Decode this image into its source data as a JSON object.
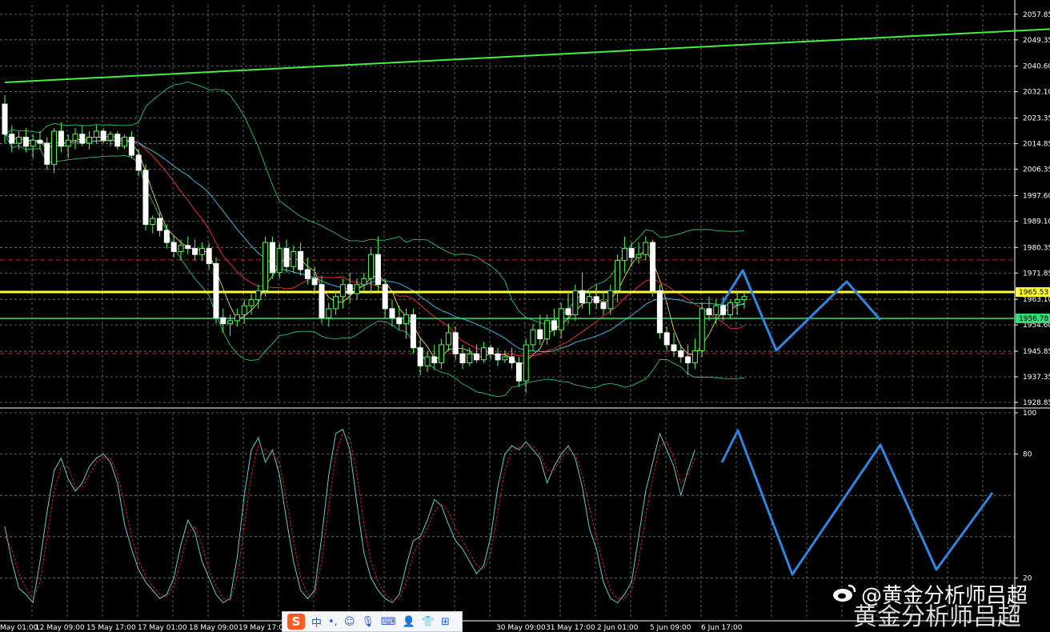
{
  "chart_data": [
    {
      "type": "candlestick",
      "panel": "price",
      "title": "",
      "ylim": [
        1928.85,
        2061
      ],
      "y_ticks": [
        "2057.85",
        "2049.35",
        "2040.60",
        "2032.10",
        "2023.35",
        "2014.85",
        "2006.35",
        "1997.60",
        "1989.10",
        "1980.35",
        "1971.85",
        "1963.10",
        "1954.60",
        "1945.85",
        "1937.35",
        "1928.85"
      ],
      "price_badges": [
        {
          "label": "1965.53",
          "value": 1965.53,
          "color": "#ffff33"
        },
        {
          "label": "1956.78",
          "value": 1956.78,
          "color": "#33dd77"
        }
      ],
      "horizontal_levels": [
        {
          "value": 1965.53,
          "color": "#ffff33",
          "style": "solid"
        },
        {
          "value": 1956.78,
          "color": "#33dd77",
          "style": "solid"
        },
        {
          "value": 1976.2,
          "color": "#cc2222",
          "style": "dashed"
        },
        {
          "value": 1945.1,
          "color": "#cc2222",
          "style": "dashed"
        }
      ],
      "trendline": {
        "from": [
          0,
          2035.2
        ],
        "to": [
          159,
          2054.2
        ],
        "color": "#44ee44"
      },
      "candles": [
        [
          2028,
          2031,
          2015,
          2018
        ],
        [
          2018,
          2021,
          2012,
          2015
        ],
        [
          2015,
          2019,
          2013,
          2017
        ],
        [
          2017,
          2020,
          2012,
          2014
        ],
        [
          2014,
          2018,
          2010,
          2016
        ],
        [
          2016,
          2019,
          2013,
          2015
        ],
        [
          2015,
          2017,
          2006,
          2008
        ],
        [
          2008,
          2020,
          2005,
          2019
        ],
        [
          2019,
          2022,
          2012,
          2014
        ],
        [
          2014,
          2018,
          2010,
          2016
        ],
        [
          2016,
          2020,
          2013,
          2018
        ],
        [
          2018,
          2021,
          2014,
          2015
        ],
        [
          2015,
          2019,
          2013,
          2017
        ],
        [
          2017,
          2021,
          2015,
          2019
        ],
        [
          2019,
          2020,
          2015,
          2016
        ],
        [
          2016,
          2019,
          2014,
          2018
        ],
        [
          2018,
          2019,
          2013,
          2014
        ],
        [
          2014,
          2018,
          2013,
          2017
        ],
        [
          2017,
          2019,
          2010,
          2011
        ],
        [
          2011,
          2013,
          2004,
          2006
        ],
        [
          2006,
          2008,
          1986,
          1988
        ],
        [
          1988,
          1991,
          1985,
          1990
        ],
        [
          1990,
          1992,
          1984,
          1986
        ],
        [
          1986,
          1988,
          1980,
          1982
        ],
        [
          1982,
          1984,
          1977,
          1979
        ],
        [
          1979,
          1983,
          1976,
          1981
        ],
        [
          1981,
          1984,
          1978,
          1980
        ],
        [
          1980,
          1983,
          1976,
          1978
        ],
        [
          1978,
          1982,
          1976,
          1980
        ],
        [
          1980,
          1982,
          1973,
          1975
        ],
        [
          1975,
          1977,
          1955,
          1957
        ],
        [
          1957,
          1960,
          1952,
          1955
        ],
        [
          1955,
          1958,
          1951,
          1956
        ],
        [
          1956,
          1960,
          1954,
          1958
        ],
        [
          1958,
          1963,
          1955,
          1961
        ],
        [
          1961,
          1965,
          1958,
          1963
        ],
        [
          1963,
          1968,
          1960,
          1966
        ],
        [
          1966,
          1984,
          1964,
          1982
        ],
        [
          1982,
          1984,
          1970,
          1972
        ],
        [
          1972,
          1982,
          1970,
          1980
        ],
        [
          1980,
          1983,
          1972,
          1974
        ],
        [
          1974,
          1981,
          1972,
          1979
        ],
        [
          1979,
          1982,
          1971,
          1973
        ],
        [
          1973,
          1977,
          1968,
          1970
        ],
        [
          1970,
          1974,
          1965,
          1968
        ],
        [
          1968,
          1971,
          1955,
          1957
        ],
        [
          1957,
          1962,
          1954,
          1960
        ],
        [
          1960,
          1966,
          1958,
          1964
        ],
        [
          1964,
          1970,
          1960,
          1968
        ],
        [
          1968,
          1972,
          1962,
          1965
        ],
        [
          1965,
          1970,
          1963,
          1968
        ],
        [
          1968,
          1972,
          1966,
          1970
        ],
        [
          1970,
          1980,
          1965,
          1978
        ],
        [
          1978,
          1984,
          1966,
          1968
        ],
        [
          1968,
          1970,
          1957,
          1960
        ],
        [
          1960,
          1963,
          1954,
          1957
        ],
        [
          1957,
          1961,
          1953,
          1955
        ],
        [
          1955,
          1960,
          1950,
          1958
        ],
        [
          1958,
          1960,
          1945,
          1947
        ],
        [
          1947,
          1950,
          1938,
          1941
        ],
        [
          1941,
          1946,
          1939,
          1944
        ],
        [
          1944,
          1948,
          1940,
          1942
        ],
        [
          1942,
          1950,
          1940,
          1948
        ],
        [
          1948,
          1955,
          1946,
          1952
        ],
        [
          1952,
          1954,
          1943,
          1945
        ],
        [
          1945,
          1948,
          1940,
          1942
        ],
        [
          1942,
          1947,
          1941,
          1945
        ],
        [
          1945,
          1948,
          1942,
          1943
        ],
        [
          1943,
          1949,
          1942,
          1947
        ],
        [
          1947,
          1948,
          1943,
          1945
        ],
        [
          1945,
          1947,
          1941,
          1943
        ],
        [
          1943,
          1946,
          1942,
          1944
        ],
        [
          1944,
          1947,
          1940,
          1942
        ],
        [
          1942,
          1944,
          1934,
          1936
        ],
        [
          1936,
          1950,
          1932,
          1948
        ],
        [
          1948,
          1955,
          1946,
          1953
        ],
        [
          1953,
          1958,
          1948,
          1950
        ],
        [
          1950,
          1958,
          1948,
          1956
        ],
        [
          1956,
          1960,
          1951,
          1953
        ],
        [
          1953,
          1962,
          1950,
          1960
        ],
        [
          1960,
          1965,
          1955,
          1958
        ],
        [
          1958,
          1968,
          1956,
          1966
        ],
        [
          1966,
          1972,
          1960,
          1962
        ],
        [
          1962,
          1966,
          1958,
          1964
        ],
        [
          1964,
          1968,
          1960,
          1962
        ],
        [
          1962,
          1966,
          1958,
          1960
        ],
        [
          1960,
          1968,
          1958,
          1966
        ],
        [
          1966,
          1978,
          1962,
          1976
        ],
        [
          1976,
          1984,
          1972,
          1980
        ],
        [
          1980,
          1982,
          1974,
          1977
        ],
        [
          1977,
          1982,
          1975,
          1978
        ],
        [
          1978,
          1984,
          1976,
          1982
        ],
        [
          1982,
          1983,
          1964,
          1966
        ],
        [
          1966,
          1968,
          1950,
          1952
        ],
        [
          1952,
          1954,
          1946,
          1948
        ],
        [
          1948,
          1952,
          1944,
          1946
        ],
        [
          1946,
          1948,
          1942,
          1944
        ],
        [
          1944,
          1948,
          1938,
          1942
        ],
        [
          1942,
          1950,
          1940,
          1946
        ],
        [
          1946,
          1962,
          1944,
          1960
        ],
        [
          1960,
          1964,
          1956,
          1958
        ],
        [
          1958,
          1963,
          1955,
          1961
        ],
        [
          1961,
          1964,
          1956,
          1958
        ],
        [
          1958,
          1963,
          1957,
          1962
        ],
        [
          1962,
          1965,
          1958,
          1963
        ],
        [
          1963,
          1966,
          1960,
          1964
        ]
      ],
      "x_labels": [
        "May 01:00",
        "12 May 09:00",
        "15 May 17:00",
        "17 May 01:00",
        "18 May 09:00",
        "19 May 17:00",
        "30 May 09:00",
        "31 May 17:00",
        "2 Jun 01:00",
        "5 Jun 09:00",
        "6 Jun 17:00"
      ],
      "projection_color": "#2f86e0"
    },
    {
      "type": "line",
      "panel": "oscillator",
      "title": "",
      "ylim": [
        0,
        100
      ],
      "y_ticks": [
        "100",
        "80",
        "20"
      ],
      "levels": [
        80,
        20
      ],
      "series": [
        {
          "color": "#66cccc",
          "style": "solid",
          "values": [
            45,
            28,
            15,
            12,
            8,
            28,
            52,
            72,
            78,
            68,
            62,
            66,
            74,
            78,
            80,
            76,
            66,
            46,
            34,
            24,
            18,
            14,
            10,
            12,
            20,
            36,
            48,
            42,
            28,
            20,
            12,
            8,
            10,
            30,
            60,
            82,
            88,
            76,
            82,
            70,
            48,
            28,
            14,
            10,
            14,
            40,
            70,
            90,
            92,
            82,
            56,
            32,
            20,
            14,
            10,
            8,
            12,
            26,
            38,
            40,
            48,
            58,
            55,
            46,
            38,
            34,
            28,
            22,
            26,
            40,
            64,
            80,
            84,
            82,
            86,
            82,
            78,
            66,
            74,
            80,
            84,
            78,
            64,
            44,
            34,
            18,
            10,
            8,
            12,
            18,
            40,
            62,
            76,
            90,
            82,
            74,
            60,
            72,
            82
          ]
        },
        {
          "color": "#cc2222",
          "style": "dashed",
          "values": [
            40,
            34,
            22,
            15,
            10,
            18,
            40,
            62,
            74,
            74,
            64,
            64,
            70,
            76,
            78,
            78,
            70,
            56,
            40,
            28,
            21,
            16,
            12,
            11,
            16,
            28,
            42,
            45,
            36,
            24,
            16,
            10,
            9,
            20,
            45,
            70,
            84,
            82,
            80,
            76,
            58,
            38,
            20,
            12,
            12,
            28,
            55,
            80,
            90,
            88,
            70,
            46,
            28,
            18,
            12,
            9,
            10,
            18,
            32,
            38,
            44,
            52,
            56,
            52,
            44,
            38,
            32,
            26,
            24,
            32,
            52,
            72,
            82,
            83,
            84,
            84,
            80,
            72,
            72,
            78,
            82,
            80,
            70,
            54,
            40,
            26,
            14,
            10,
            10,
            14,
            28,
            50,
            68,
            84,
            86,
            78,
            66,
            70,
            78
          ]
        }
      ]
    }
  ],
  "overlay": {
    "ime_toolbar": {
      "logo": "S",
      "items": [
        "中",
        "•,",
        "☺",
        "🎙",
        "⌨",
        "👤",
        "👕",
        "⊞"
      ]
    },
    "watermark": {
      "line1": "@黄金分析师吕超",
      "line2": "黄金分析师吕超",
      "logo_icon": "weibo-icon"
    }
  }
}
